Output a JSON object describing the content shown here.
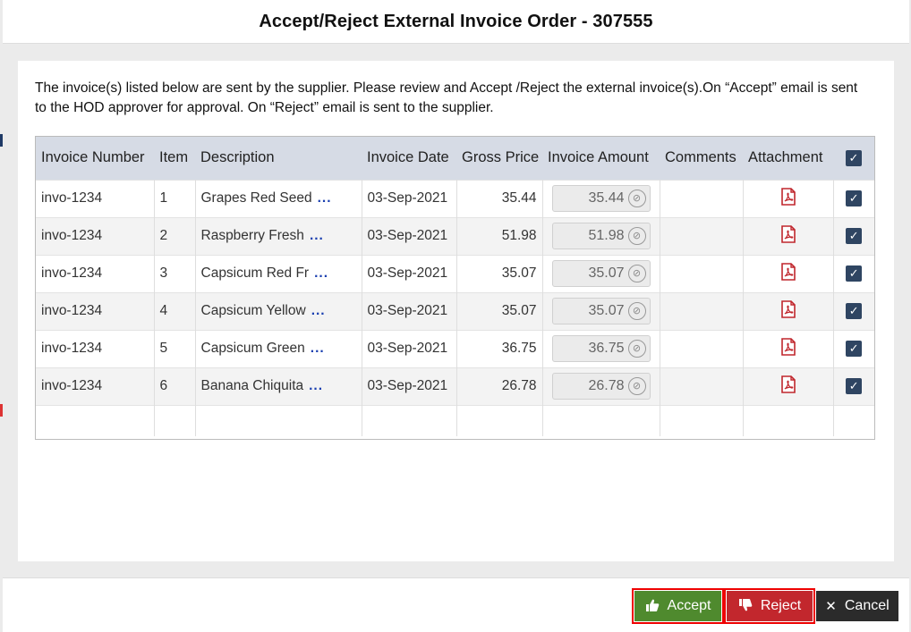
{
  "dialog": {
    "title": "Accept/Reject External Invoice Order - 307555",
    "description": "The invoice(s) listed below are sent by the supplier. Please review and Accept /Reject the external invoice(s).On “Accept” email is sent to the HOD approver for approval. On “Reject” email is sent to the supplier."
  },
  "table": {
    "headers": {
      "invoice_number": "Invoice Number",
      "item": "Item",
      "description": "Description",
      "invoice_date": "Invoice Date",
      "gross_price": "Gross Price",
      "invoice_amount": "Invoice Amount",
      "comments": "Comments",
      "attachment": "Attachment"
    },
    "select_all_checked": true,
    "ellipsis": "...",
    "rows": [
      {
        "invoice_number": "invo-1234",
        "item": "1",
        "description": "Grapes Red Seed",
        "invoice_date": "03-Sep-2021",
        "gross_price": "35.44",
        "invoice_amount": "35.44",
        "comments": "",
        "checked": true
      },
      {
        "invoice_number": "invo-1234",
        "item": "2",
        "description": "Raspberry Fresh",
        "invoice_date": "03-Sep-2021",
        "gross_price": "51.98",
        "invoice_amount": "51.98",
        "comments": "",
        "checked": true
      },
      {
        "invoice_number": "invo-1234",
        "item": "3",
        "description": "Capsicum Red Fr",
        "invoice_date": "03-Sep-2021",
        "gross_price": "35.07",
        "invoice_amount": "35.07",
        "comments": "",
        "checked": true
      },
      {
        "invoice_number": "invo-1234",
        "item": "4",
        "description": "Capsicum Yellow",
        "invoice_date": "03-Sep-2021",
        "gross_price": "35.07",
        "invoice_amount": "35.07",
        "comments": "",
        "checked": true
      },
      {
        "invoice_number": "invo-1234",
        "item": "5",
        "description": "Capsicum Green",
        "invoice_date": "03-Sep-2021",
        "gross_price": "36.75",
        "invoice_amount": "36.75",
        "comments": "",
        "checked": true
      },
      {
        "invoice_number": "invo-1234",
        "item": "6",
        "description": "Banana Chiquita",
        "invoice_date": "03-Sep-2021",
        "gross_price": "26.78",
        "invoice_amount": "26.78",
        "comments": "",
        "checked": true
      }
    ]
  },
  "footer": {
    "accept_label": "Accept",
    "reject_label": "Reject",
    "cancel_label": "Cancel"
  },
  "icons": {
    "attachment": "pdf-icon",
    "accept": "thumbs-up-icon",
    "reject": "thumbs-down-icon",
    "cancel": "close-icon",
    "amount_clear": "clear-circle-icon"
  },
  "colors": {
    "accept": "#4f8a2e",
    "reject": "#c2272d",
    "cancel": "#2b2b2b",
    "header_row": "#d6dbe5",
    "checkbox": "#2f4562",
    "ellipsis": "#1a3fb0",
    "pdf": "#c0272d",
    "highlight_outline": "#ee0000"
  }
}
